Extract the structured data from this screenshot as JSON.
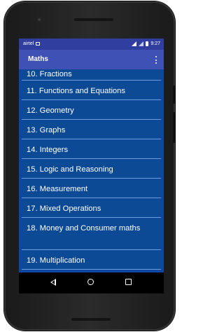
{
  "status_bar": {
    "carrier": "airtel",
    "time": "9:27"
  },
  "app_bar": {
    "title": "Maths"
  },
  "topics": [
    "10. Fractions",
    "11. Functions and Equations",
    "12. Geometry",
    "13. Graphs",
    "14. Integers",
    "15. Logic and Reasoning",
    "16. Measurement",
    "17. Mixed Operations",
    "18. Money and Consumer maths",
    "19. Multiplication"
  ],
  "icons": {
    "status_notification": "image-icon",
    "status_signal_1": "signal-icon",
    "status_signal_2": "signal-icon",
    "status_battery": "battery-icon",
    "app_menu": "overflow-menu-icon",
    "nav_back": "back-icon",
    "nav_home": "home-icon",
    "nav_recents": "recents-icon"
  },
  "colors": {
    "status_bar": "#303f9f",
    "app_bar": "#3f51b5",
    "list_background": "#0d47a1",
    "list_item": "#0d4a96",
    "divider": "#6f9fd8",
    "text": "#ffffff"
  }
}
